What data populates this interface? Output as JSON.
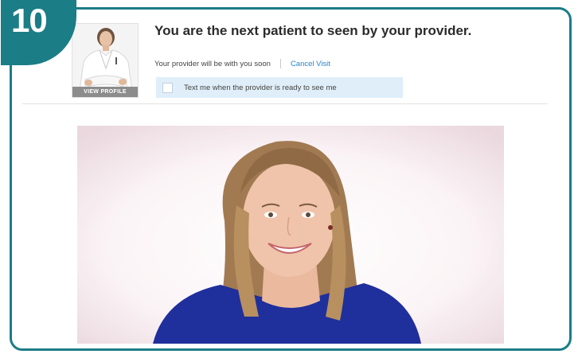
{
  "step": {
    "number": "10"
  },
  "provider": {
    "view_profile_label": "VIEW PROFILE"
  },
  "status": {
    "title": "You are the next patient to seen by your provider.",
    "wait_message": "Your provider will be with you soon",
    "cancel_label": "Cancel Visit",
    "sms_label": "Text me when the provider is ready to see me",
    "sms_checked": false
  },
  "colors": {
    "accent": "#1b7d86",
    "link": "#2a86c9",
    "sms_background": "#dfeef8",
    "video_shirt": "#1f2f9c"
  }
}
